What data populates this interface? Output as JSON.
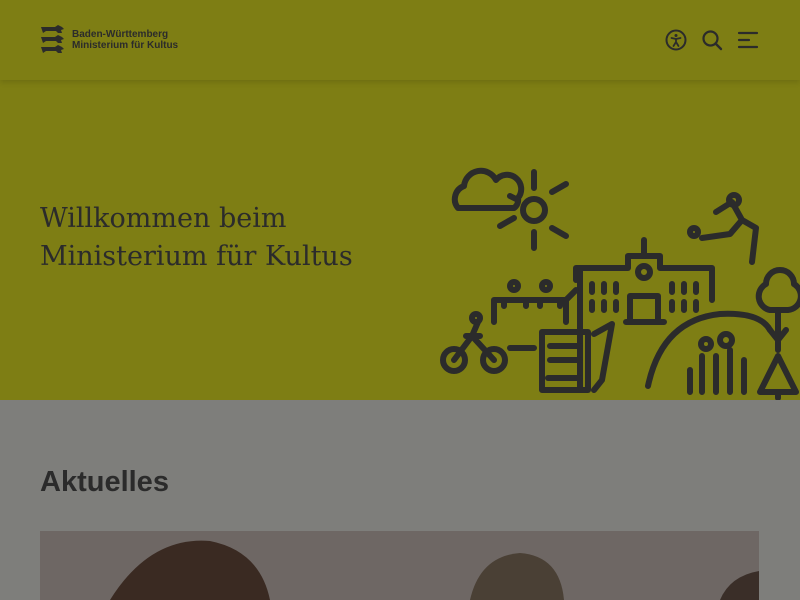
{
  "header": {
    "logo": {
      "line1": "Baden-Württemberg",
      "line2": "Ministerium für Kultus"
    },
    "icons": [
      "accessibility-icon",
      "search-icon",
      "menu-icon"
    ]
  },
  "hero": {
    "title_line1": "Willkommen beim",
    "title_line2": "Ministerium für Kultus",
    "background": "#7e7e14"
  },
  "news": {
    "title": "Aktuelles"
  },
  "colors": {
    "accent": "#7e7e14",
    "ink": "#2b2b2b",
    "overlay_gray": "#7e7e7b"
  }
}
